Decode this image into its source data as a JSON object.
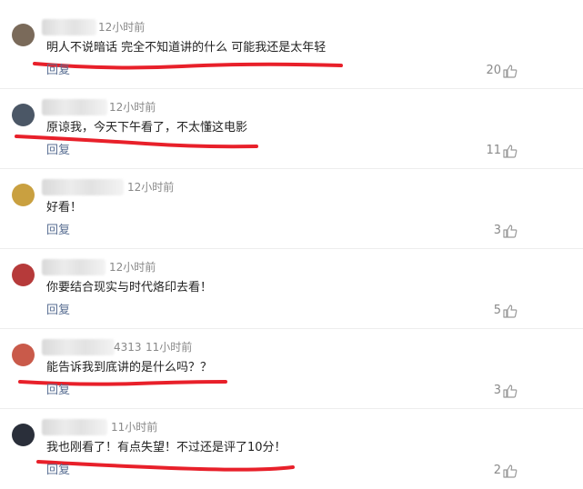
{
  "comments": [
    {
      "name_suffix": "",
      "time": "12小时前",
      "text": "明人不说暗话 完全不知道讲的什么 可能我还是太年轻",
      "reply": "回复",
      "likes": "20"
    },
    {
      "name_suffix": "",
      "time": "12小时前",
      "text": "原谅我，今天下午看了，不太懂这电影",
      "reply": "回复",
      "likes": "11"
    },
    {
      "name_suffix": "",
      "time": "12小时前",
      "text": "好看！",
      "reply": "回复",
      "likes": "3"
    },
    {
      "name_suffix": "",
      "time": "12小时前",
      "text": "你要结合现实与时代烙印去看！",
      "reply": "回复",
      "likes": "5"
    },
    {
      "name_suffix": "4313",
      "time": "11小时前",
      "text": "能告诉我到底讲的是什么吗？？",
      "reply": "回复",
      "likes": "3"
    },
    {
      "name_suffix": "",
      "time": "11小时前",
      "text": "我也刚看了！有点失望！不过还是评了10分！",
      "reply": "回复",
      "likes": "2"
    }
  ],
  "colors": {
    "annotation_red": "#e8202a",
    "reply_link": "#5a6f93",
    "meta_text": "#888888"
  },
  "icons": {
    "like": "thumbs-up-icon"
  }
}
